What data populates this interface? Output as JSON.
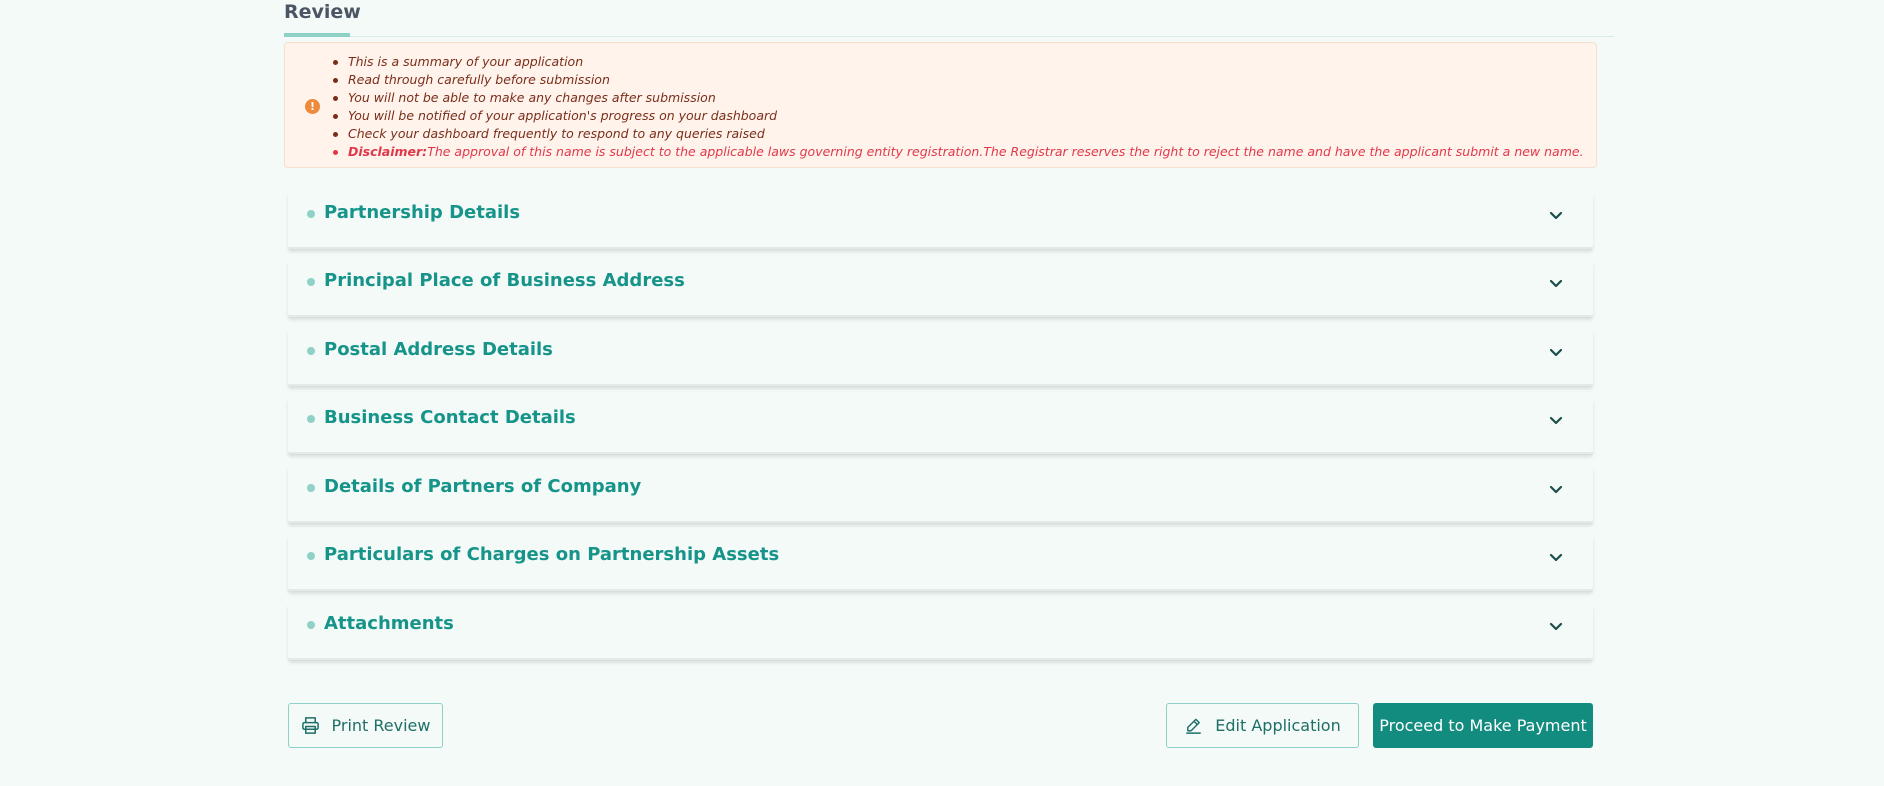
{
  "tabs": {
    "review_label": "Review"
  },
  "notice": {
    "icon": "exclamation-icon",
    "items": [
      "This is a summary of your application",
      "Read through carefully before submission",
      "You will not be able to make any changes after submission",
      "You will be notified of your application's progress on your dashboard",
      "Check your dashboard frequently to respond to any queries raised"
    ],
    "disclaimer_label": "Disclaimer:",
    "disclaimer_text": "The approval of this name is subject to the applicable laws governing entity registration.The Registrar reserves the right to reject the name and have the applicant submit a new name."
  },
  "sections": [
    {
      "title": "Partnership Details"
    },
    {
      "title": "Principal Place of Business Address"
    },
    {
      "title": "Postal Address Details"
    },
    {
      "title": "Business Contact Details"
    },
    {
      "title": "Details of Partners of Company"
    },
    {
      "title": "Particulars of Charges on Partnership Assets"
    },
    {
      "title": "Attachments"
    }
  ],
  "actions": {
    "print_label": "Print Review",
    "edit_label": "Edit Application",
    "payment_label": "Proceed to Make Payment"
  },
  "colors": {
    "background": "#f3faf7",
    "accent": "#138c80",
    "section_title": "#16948a",
    "notice_background": "#fff3eb",
    "notice_text": "#7a2e1a",
    "disclaimer_text": "#e0384b",
    "notice_icon": "#ee8a3b"
  }
}
